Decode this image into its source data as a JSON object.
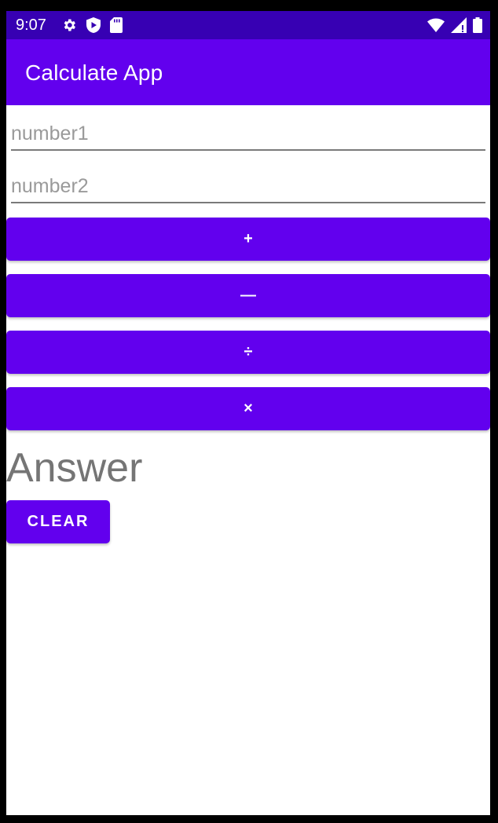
{
  "status_bar": {
    "time": "9:07",
    "icons_left": [
      "gear-icon",
      "shield-play-icon",
      "sd-card-icon"
    ],
    "icons_right": [
      "wifi-icon",
      "cellular-signal-icon",
      "battery-icon"
    ]
  },
  "app_bar": {
    "title": "Calculate App"
  },
  "inputs": {
    "number1": {
      "value": "",
      "placeholder": "number1"
    },
    "number2": {
      "value": "",
      "placeholder": "number2"
    }
  },
  "operations": {
    "add_label": "+",
    "subtract_label": "—",
    "divide_label": "÷",
    "multiply_label": "×"
  },
  "result": {
    "answer_text": "Answer"
  },
  "actions": {
    "clear_label": "CLEAR"
  },
  "colors": {
    "primary": "#6200ee",
    "primary_dark": "#3700b3",
    "answer_text": "#757575"
  }
}
